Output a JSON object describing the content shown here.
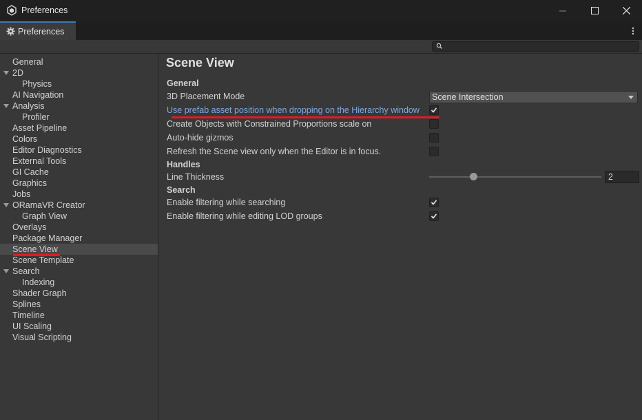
{
  "window": {
    "title": "Preferences",
    "app_icon": "unity-icon",
    "minimize_icon": "minimize-icon",
    "maximize_icon": "maximize-icon",
    "close_icon": "close-icon"
  },
  "tab": {
    "label": "Preferences",
    "icon": "gear-icon",
    "menu_icon": "kebab-menu-icon"
  },
  "search": {
    "placeholder": "",
    "value": "",
    "icon": "search-icon"
  },
  "sidebar": {
    "items": [
      {
        "label": "General",
        "indent": 0,
        "expandable": false
      },
      {
        "label": "2D",
        "indent": 0,
        "expandable": true
      },
      {
        "label": "Physics",
        "indent": 1,
        "expandable": false
      },
      {
        "label": "AI Navigation",
        "indent": 0,
        "expandable": false
      },
      {
        "label": "Analysis",
        "indent": 0,
        "expandable": true
      },
      {
        "label": "Profiler",
        "indent": 1,
        "expandable": false
      },
      {
        "label": "Asset Pipeline",
        "indent": 0,
        "expandable": false
      },
      {
        "label": "Colors",
        "indent": 0,
        "expandable": false
      },
      {
        "label": "Editor Diagnostics",
        "indent": 0,
        "expandable": false
      },
      {
        "label": "External Tools",
        "indent": 0,
        "expandable": false
      },
      {
        "label": "GI Cache",
        "indent": 0,
        "expandable": false
      },
      {
        "label": "Graphics",
        "indent": 0,
        "expandable": false
      },
      {
        "label": "Jobs",
        "indent": 0,
        "expandable": false
      },
      {
        "label": "ORamaVR Creator",
        "indent": 0,
        "expandable": true
      },
      {
        "label": "Graph View",
        "indent": 1,
        "expandable": false
      },
      {
        "label": "Overlays",
        "indent": 0,
        "expandable": false
      },
      {
        "label": "Package Manager",
        "indent": 0,
        "expandable": false
      },
      {
        "label": "Scene View",
        "indent": 0,
        "expandable": false,
        "selected": true
      },
      {
        "label": "Scene Template",
        "indent": 0,
        "expandable": false
      },
      {
        "label": "Search",
        "indent": 0,
        "expandable": true
      },
      {
        "label": "Indexing",
        "indent": 1,
        "expandable": false
      },
      {
        "label": "Shader Graph",
        "indent": 0,
        "expandable": false
      },
      {
        "label": "Splines",
        "indent": 0,
        "expandable": false
      },
      {
        "label": "Timeline",
        "indent": 0,
        "expandable": false
      },
      {
        "label": "UI Scaling",
        "indent": 0,
        "expandable": false
      },
      {
        "label": "Visual Scripting",
        "indent": 0,
        "expandable": false
      }
    ]
  },
  "main": {
    "title": "Scene View",
    "general": {
      "header": "General",
      "placement_mode_label": "3D Placement Mode",
      "placement_mode_value": "Scene Intersection",
      "prefab_position_label": "Use prefab asset position when dropping on the Hierarchy window",
      "prefab_position_checked": true,
      "constrained_label": "Create Objects with Constrained Proportions scale on",
      "constrained_checked": false,
      "autohide_label": "Auto-hide gizmos",
      "autohide_checked": false,
      "refresh_label": "Refresh the Scene view only when the Editor is in focus.",
      "refresh_checked": false
    },
    "handles": {
      "header": "Handles",
      "line_thickness_label": "Line Thickness",
      "line_thickness_value": "2"
    },
    "search": {
      "header": "Search",
      "filter_searching_label": "Enable filtering while searching",
      "filter_searching_checked": true,
      "filter_lod_label": "Enable filtering while editing LOD groups",
      "filter_lod_checked": true
    }
  },
  "colors": {
    "accent": "#3a79bb",
    "highlight_text": "#7fa8e0",
    "annotation_red": "#e01b24"
  }
}
